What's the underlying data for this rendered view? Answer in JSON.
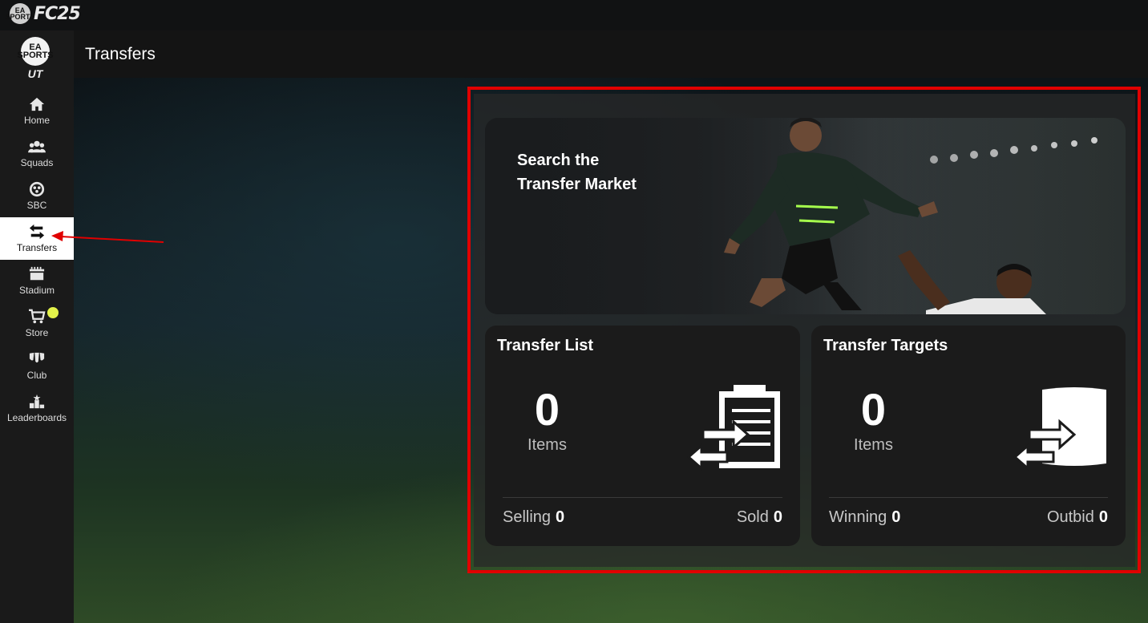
{
  "app": {
    "ea_badge": "EA SPORTS",
    "logo_text": "FC25",
    "ut_badge": "EA SPORTS",
    "ut_text": "UT"
  },
  "header": {
    "title": "Transfers"
  },
  "nav": {
    "items": [
      {
        "label": "Home",
        "icon": "home-icon"
      },
      {
        "label": "Squads",
        "icon": "squads-icon"
      },
      {
        "label": "SBC",
        "icon": "sbc-icon"
      },
      {
        "label": "Transfers",
        "icon": "transfers-icon",
        "active": true
      },
      {
        "label": "Stadium",
        "icon": "stadium-icon"
      },
      {
        "label": "Store",
        "icon": "store-icon",
        "notification": true
      },
      {
        "label": "Club",
        "icon": "club-icon"
      },
      {
        "label": "Leaderboards",
        "icon": "leaderboards-icon"
      }
    ]
  },
  "banner": {
    "title_line1": "Search the",
    "title_line2": "Transfer Market"
  },
  "transfer_list": {
    "title": "Transfer List",
    "count": "0",
    "count_label": "Items",
    "left_stat_label": "Selling",
    "left_stat_value": "0",
    "right_stat_label": "Sold",
    "right_stat_value": "0"
  },
  "transfer_targets": {
    "title": "Transfer Targets",
    "count": "0",
    "count_label": "Items",
    "left_stat_label": "Winning",
    "left_stat_value": "0",
    "right_stat_label": "Outbid",
    "right_stat_value": "0"
  },
  "colors": {
    "highlight": "#e00000",
    "store_dot": "#e3f24a"
  }
}
